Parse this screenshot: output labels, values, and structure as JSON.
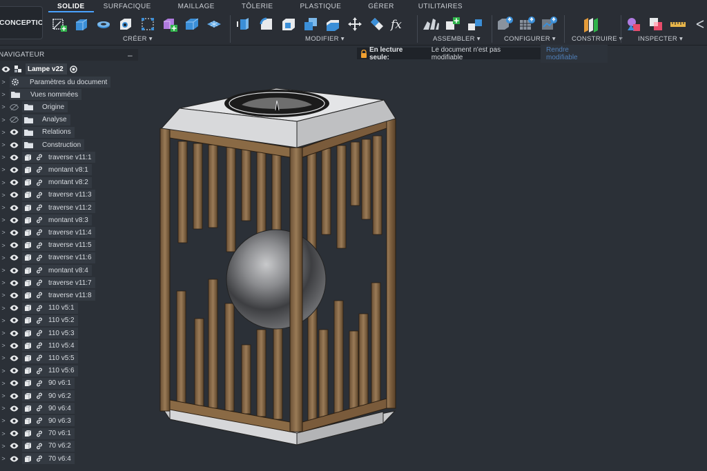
{
  "workspace": {
    "label": "CONCEPTION",
    "caret": "▾"
  },
  "tabs": [
    {
      "label": "SOLIDE",
      "active": true
    },
    {
      "label": "SURFACIQUE",
      "active": false
    },
    {
      "label": "MAILLAGE",
      "active": false
    },
    {
      "label": "TÔLERIE",
      "active": false
    },
    {
      "label": "PLASTIQUE",
      "active": false
    },
    {
      "label": "GÉRER",
      "active": false
    },
    {
      "label": "UTILITAIRES",
      "active": false
    }
  ],
  "groups": {
    "create": {
      "label": "CRÉER ▾",
      "icons": [
        "sketch-create-icon",
        "extrude-icon",
        "revolve-icon",
        "hole-icon",
        "rectangular-pattern-icon",
        "new-component-icon",
        "box-primitive-icon",
        "mesh-plane-icon"
      ]
    },
    "modify": {
      "label": "MODIFIER ▾",
      "icons": [
        "press-pull-icon",
        "fillet-icon",
        "shell-icon",
        "combine-icon",
        "offset-face-icon",
        "move-icon",
        "split-body-icon",
        "parameters-fx-icon"
      ]
    },
    "assemble": {
      "label": "ASSEMBLER ▾",
      "icons": [
        "joint-icon",
        "new-component-plus-icon",
        "rigid-group-icon"
      ]
    },
    "configure": {
      "label": "CONFIGURER ▾",
      "icons": [
        "configure-icon",
        "configure-table-icon",
        "configure-rule-icon"
      ]
    },
    "construct": {
      "label": "CONSTRUIRE ▾",
      "icons": [
        "offset-plane-icon"
      ]
    },
    "inspect": {
      "label": "INSPECTER ▾",
      "icons": [
        "shapes-icon",
        "interference-icon",
        "measure-icon"
      ]
    }
  },
  "navigator": {
    "title": "NAVIGATEUR",
    "collapse": "–"
  },
  "document": {
    "name": "Lampe v22"
  },
  "tree": [
    {
      "label": "Paramètres du document",
      "icon": "gear-icon",
      "eye": "none",
      "kind": "folder-level"
    },
    {
      "label": "Vues nommées",
      "icon": "folder-icon",
      "eye": "none",
      "kind": "folder-level"
    },
    {
      "label": "Origine",
      "icon": "folder-icon",
      "eye": "hidden",
      "kind": "folder"
    },
    {
      "label": "Analyse",
      "icon": "folder-icon",
      "eye": "hidden",
      "kind": "folder"
    },
    {
      "label": "Relations",
      "icon": "folder-icon",
      "eye": "visible",
      "kind": "folder"
    },
    {
      "label": "Construction",
      "icon": "folder-icon",
      "eye": "visible",
      "kind": "folder"
    },
    {
      "label": "traverse v11:1",
      "kind": "component",
      "eye": "visible"
    },
    {
      "label": "montant v8:1",
      "kind": "component",
      "eye": "visible"
    },
    {
      "label": "montant v8:2",
      "kind": "component",
      "eye": "visible"
    },
    {
      "label": "traverse v11:3",
      "kind": "component",
      "eye": "visible"
    },
    {
      "label": "traverse v11:2",
      "kind": "component",
      "eye": "visible"
    },
    {
      "label": "montant v8:3",
      "kind": "component",
      "eye": "visible"
    },
    {
      "label": "traverse v11:4",
      "kind": "component",
      "eye": "visible"
    },
    {
      "label": "traverse v11:5",
      "kind": "component",
      "eye": "visible"
    },
    {
      "label": "traverse v11:6",
      "kind": "component",
      "eye": "visible"
    },
    {
      "label": "montant v8:4",
      "kind": "component",
      "eye": "visible"
    },
    {
      "label": "traverse v11:7",
      "kind": "component",
      "eye": "visible"
    },
    {
      "label": "traverse v11:8",
      "kind": "component",
      "eye": "visible"
    },
    {
      "label": "110 v5:1",
      "kind": "component",
      "eye": "visible"
    },
    {
      "label": "110 v5:2",
      "kind": "component",
      "eye": "visible"
    },
    {
      "label": "110 v5:3",
      "kind": "component",
      "eye": "visible"
    },
    {
      "label": "110 v5:4",
      "kind": "component",
      "eye": "visible"
    },
    {
      "label": "110 v5:5",
      "kind": "component",
      "eye": "visible"
    },
    {
      "label": "110 v5:6",
      "kind": "component",
      "eye": "visible"
    },
    {
      "label": "90 v6:1",
      "kind": "component",
      "eye": "visible"
    },
    {
      "label": "90 v6:2",
      "kind": "component",
      "eye": "visible"
    },
    {
      "label": "90 v6:4",
      "kind": "component",
      "eye": "visible"
    },
    {
      "label": "90 v6:3",
      "kind": "component",
      "eye": "visible"
    },
    {
      "label": "70 v6:1",
      "kind": "component",
      "eye": "visible"
    },
    {
      "label": "70 v6:2",
      "kind": "component",
      "eye": "visible"
    },
    {
      "label": "70 v6:4",
      "kind": "component",
      "eye": "visible"
    }
  ],
  "readonly": {
    "title": "En lecture seule:",
    "message": "Le document n'est pas modifiable",
    "action": "Rendre modifiable"
  },
  "colors": {
    "toolbar": "#2a2e35",
    "viewport": "#2b3037",
    "accent": "#4aa3ff",
    "wood": "#8a6a45",
    "cap": "#d9dadb"
  }
}
